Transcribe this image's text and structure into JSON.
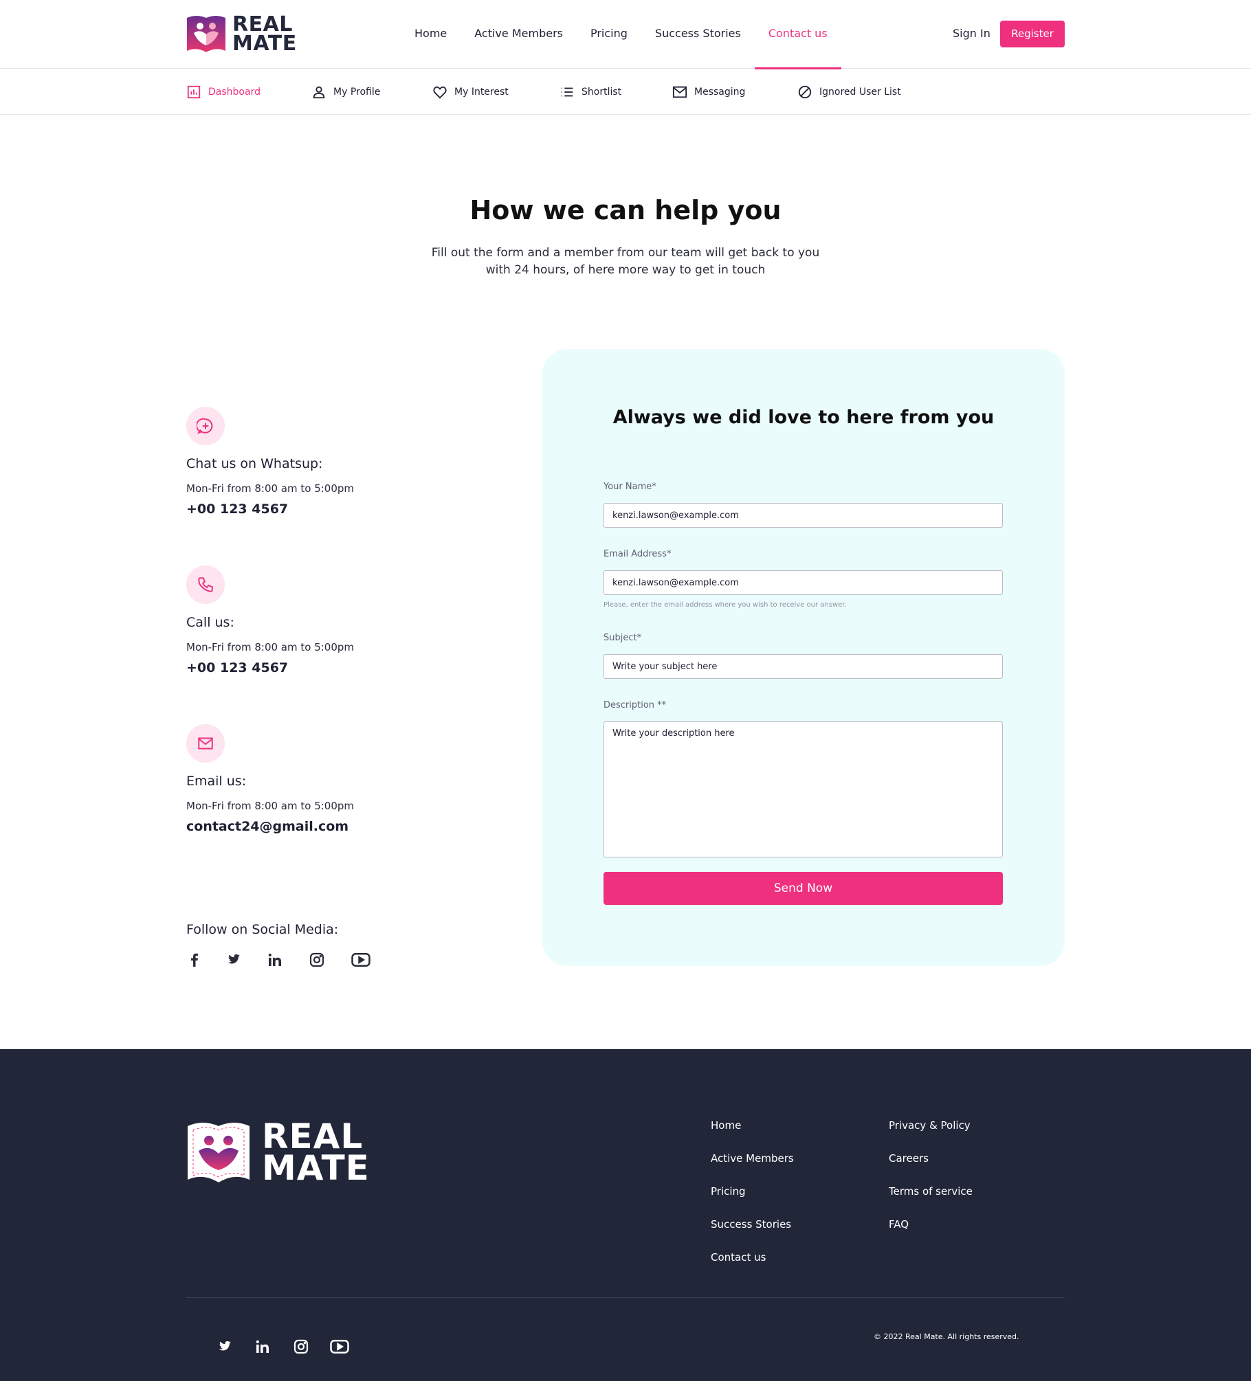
{
  "brand": {
    "line1": "REAL",
    "line2": "MATE"
  },
  "nav": {
    "items": [
      "Home",
      "Active Members",
      "Pricing",
      "Success Stories",
      "Contact us"
    ],
    "active": "Contact us",
    "signin": "Sign In",
    "register": "Register"
  },
  "subnav": {
    "items": [
      {
        "label": "Dashboard",
        "icon": "chart-icon"
      },
      {
        "label": "My Profile",
        "icon": "user-icon"
      },
      {
        "label": "My Interest",
        "icon": "heart-icon"
      },
      {
        "label": "Shortlist",
        "icon": "list-icon"
      },
      {
        "label": "Messaging",
        "icon": "mail-icon"
      },
      {
        "label": "Ignored User List",
        "icon": "block-icon"
      }
    ],
    "active": "Dashboard"
  },
  "hero": {
    "title": "How we can help you",
    "subtitle": "Fill out the form and a member from our team will get back to you with 24 hours, of here more way to get in touch"
  },
  "contact": [
    {
      "title": "Chat us on Whatsup:",
      "hours": "Mon-Fri from 8:00 am to 5:00pm",
      "value": "+00 123 4567",
      "icon": "chat-icon"
    },
    {
      "title": "Call us:",
      "hours": "Mon-Fri from 8:00 am to 5:00pm",
      "value": "+00 123 4567",
      "icon": "phone-icon"
    },
    {
      "title": "Email us:",
      "hours": "Mon-Fri from 8:00 am to 5:00pm",
      "value": "contact24@gmail.com",
      "icon": "mail-icon"
    }
  ],
  "social": {
    "title": "Follow on Social Media:",
    "icons": [
      "facebook-icon",
      "twitter-icon",
      "linkedin-icon",
      "instagram-icon",
      "youtube-icon"
    ]
  },
  "form": {
    "title": "Always we did love to here from you",
    "name_label": "Your Name*",
    "name_value": "kenzi.lawson@example.com",
    "email_label": "Email  Address*",
    "email_value": "kenzi.lawson@example.com",
    "email_help": "Please, enter the email address where you wish to receive our answer.",
    "subject_label": "Subject*",
    "subject_placeholder": "Write your subject here",
    "description_label": "Description **",
    "description_placeholder": "Write your description here",
    "submit": "Send Now"
  },
  "footer": {
    "col1": [
      "Home",
      "Active Members",
      "Pricing",
      "Success Stories",
      "Contact us"
    ],
    "col2": [
      "Privacy & Policy",
      "Careers",
      "Terms of service",
      "FAQ"
    ],
    "social_icons": [
      "twitter-icon",
      "linkedin-icon",
      "instagram-icon",
      "youtube-icon"
    ],
    "copyright": "© 2022 Real Mate. All rights reserved."
  },
  "colors": {
    "accent": "#ee307f",
    "dark": "#222639",
    "card": "#ebfcfc",
    "icon_bg": "#fde4ef"
  }
}
